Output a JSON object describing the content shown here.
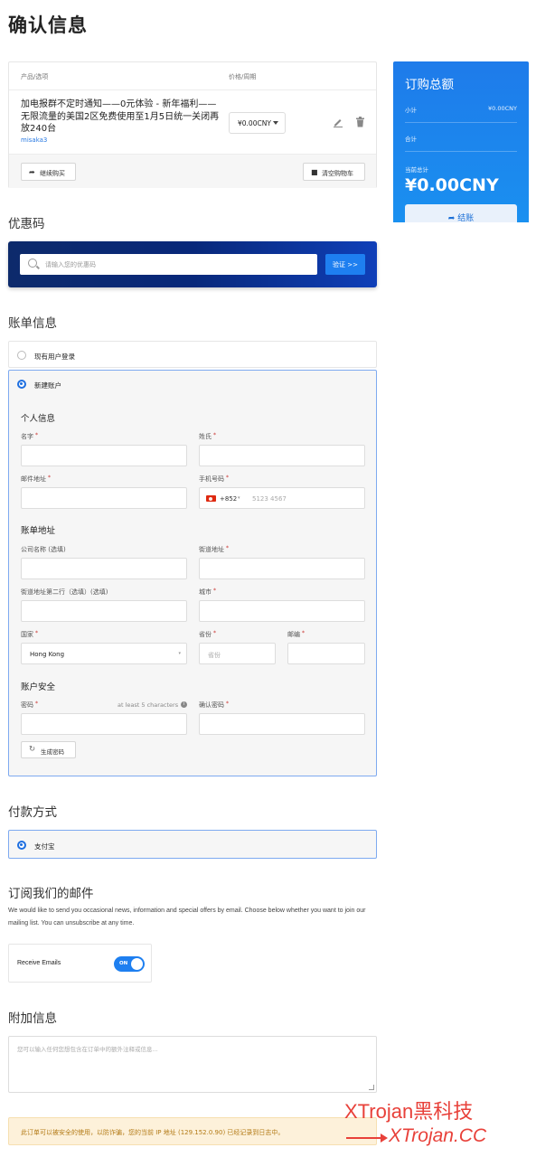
{
  "page": {
    "title": "确认信息"
  },
  "cart": {
    "col_product": "产品/选项",
    "col_price": "价格/周期",
    "item_title": "加电报群不定时通知——0元体验 - 新年福利——无限流量的美国2区免费使用至1月5日统一关闭再放240台",
    "item_sub": "misaka3",
    "price": "¥0.00CNY",
    "continue_label": "继续购买",
    "empty_label": "清空购物车"
  },
  "summary": {
    "title": "订购总额",
    "subtotal_label": "小计",
    "subtotal_value": "¥0.00CNY",
    "total_label": "合计",
    "due_label": "当前总计",
    "due_value": "¥0.00CNY",
    "checkout_label": "结账"
  },
  "promo": {
    "heading": "优惠码",
    "placeholder": "请输入您的优惠码",
    "validate_label": "验证 >>"
  },
  "billing": {
    "heading": "账单信息",
    "existing_label": "现有用户登录",
    "new_label": "新建账户",
    "personal_heading": "个人信息",
    "first_name": "名字",
    "last_name": "姓氏",
    "email": "邮件地址",
    "phone": "手机号码",
    "phone_code": "+852",
    "phone_placeholder": "5123 4567",
    "address_heading": "账单地址",
    "company": "公司名称 (选填)",
    "street": "街道地址",
    "street2": "街道地址第二行（选填）(选填)",
    "city": "城市",
    "country": "国家",
    "country_value": "Hong Kong",
    "state": "省份",
    "state_placeholder": "省份",
    "postcode": "邮编",
    "security_heading": "账户安全",
    "password": "密码",
    "password_hint": "at least 5 characters",
    "confirm_password": "确认密码",
    "generate_label": "生成密码"
  },
  "payment": {
    "heading": "付款方式",
    "method": "支付宝"
  },
  "mailing": {
    "heading": "订阅我们的邮件",
    "description": "We would like to send you occasional news, information and special offers by email. Choose below whether you want to join our mailing list. You can unsubscribe at any time.",
    "receive_label": "Receive Emails",
    "toggle_state": "ON"
  },
  "additional": {
    "heading": "附加信息",
    "placeholder": "您可以输入任何您想包含在订单中的额外注释或信息..."
  },
  "notice": {
    "text": "此订单可以被安全的使用，以防诈骗，您的当前 IP 地址 (129.152.0.90) 已经记录到日志中。"
  },
  "watermark": {
    "line1": "XTrojan黑科技",
    "line2": "XTrojan.CC"
  },
  "colors": {
    "accent": "#1e7ff0",
    "summary_bg": "#1e7bea",
    "promo_bg": "#0d2a6b"
  }
}
